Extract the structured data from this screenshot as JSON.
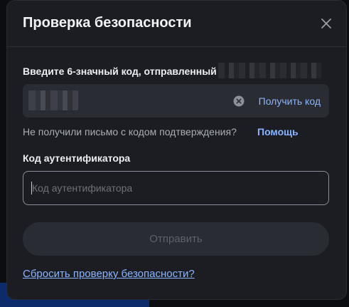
{
  "modal": {
    "title": "Проверка безопасности",
    "close_icon": "close-icon"
  },
  "code_section": {
    "label": "Введите 6-значный код, отправленный на",
    "get_code_label": "Получить код",
    "clear_icon": "clear-circle-icon"
  },
  "help": {
    "question": "Не получили письмо с кодом подтверждения?",
    "link_label": "Помощь"
  },
  "auth_section": {
    "label": "Код аутентификатора",
    "placeholder": "Код аутентификатора",
    "value": ""
  },
  "submit_label": "Отправить",
  "reset_link_label": "Сбросить проверку безопасности?",
  "colors": {
    "modal_bg": "#1c1d22",
    "field_bg": "#2a2c33",
    "link": "#8ab4ff",
    "text": "#eceef2",
    "muted": "#a9adb6"
  }
}
